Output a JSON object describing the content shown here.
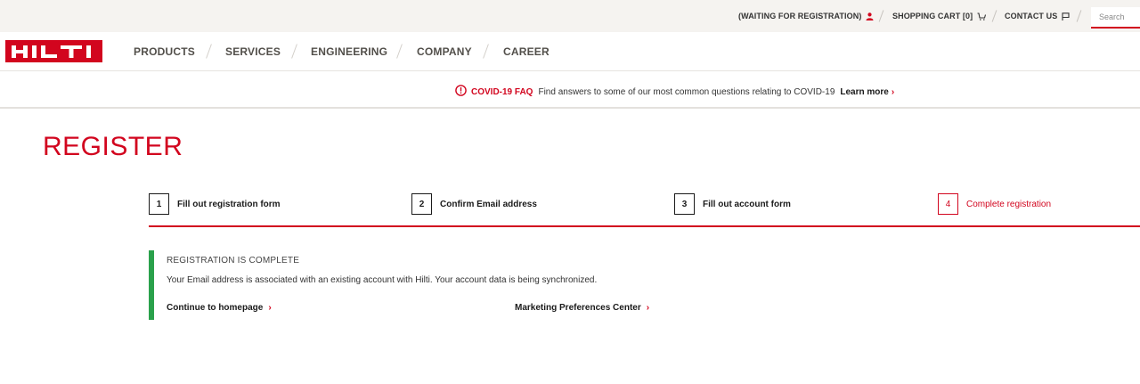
{
  "utility": {
    "registration_status": "(WAITING FOR REGISTRATION)",
    "shopping_cart": "SHOPPING CART [0]",
    "contact_us": "CONTACT US",
    "search_placeholder": "Search"
  },
  "brand": {
    "logo_text": "HILTI",
    "accent_color": "#d2051e"
  },
  "nav": {
    "items": [
      "PRODUCTS",
      "SERVICES",
      "ENGINEERING",
      "COMPANY",
      "CAREER"
    ]
  },
  "covid": {
    "title": "COVID-19 FAQ",
    "text": "Find answers to some of our most common questions relating to COVID-19",
    "link": "Learn more"
  },
  "page": {
    "title": "REGISTER"
  },
  "stepper": {
    "steps": [
      {
        "number": "1",
        "label": "Fill out registration form"
      },
      {
        "number": "2",
        "label": "Confirm Email address"
      },
      {
        "number": "3",
        "label": "Fill out account form"
      },
      {
        "number": "4",
        "label": "Complete registration"
      }
    ],
    "active_step": 4
  },
  "message": {
    "title": "REGISTRATION IS COMPLETE",
    "text": "Your Email address is associated with an existing account with Hilti. Your account data is being synchronized.",
    "link_homepage": "Continue to homepage",
    "link_marketing": "Marketing Preferences Center",
    "status_color": "#2aa14b"
  }
}
